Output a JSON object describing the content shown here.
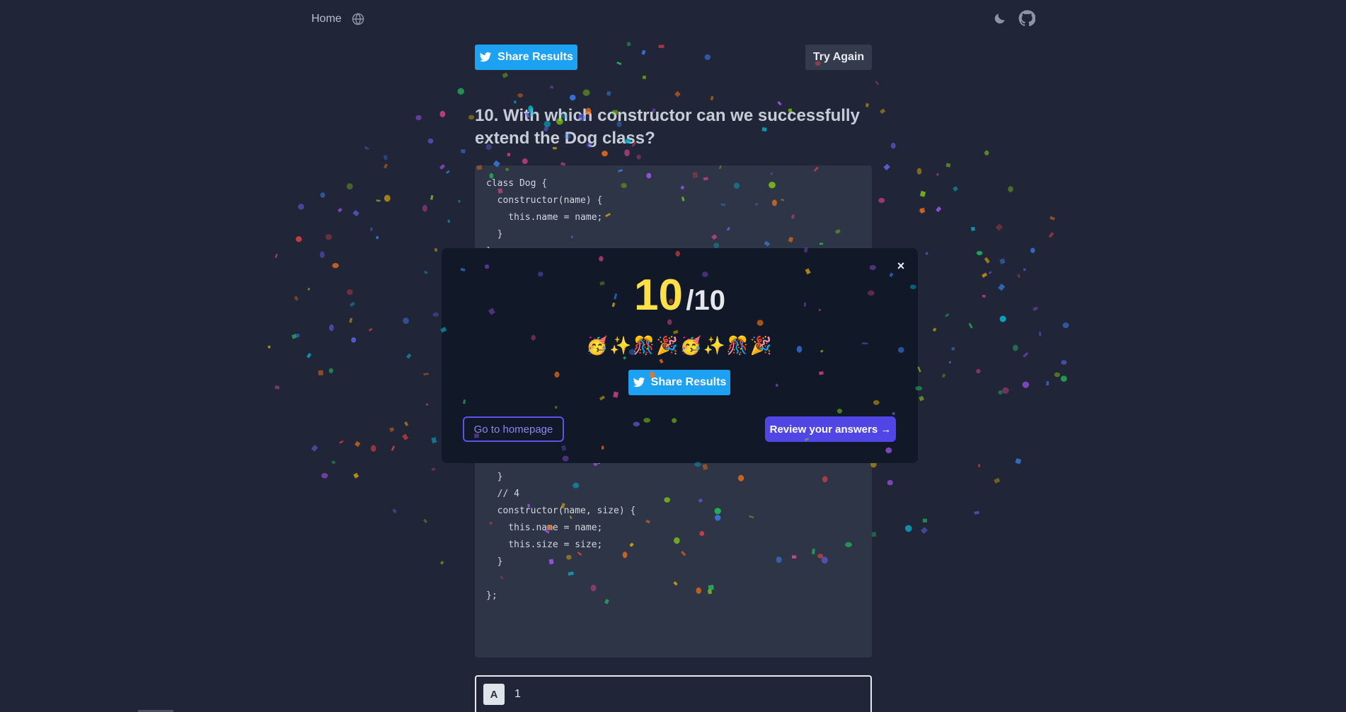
{
  "nav": {
    "home": "Home",
    "globe_icon": "globe-icon",
    "theme_icon": "moon-icon",
    "repo_icon": "github-icon"
  },
  "quiz": {
    "share_label": "Share Results",
    "try_again_label": "Try Again",
    "question": "10. With which constructor can we successfully extend the Dog class?",
    "code_top": "class Dog {\n  constructor(name) {\n    this.name = name;\n  }\n};",
    "code_bottom": "  constructor(size) {\n    super(name);\n    this.size = size;\n  }\n  // 4\n  constructor(name, size) {\n    this.name = name;\n    this.size = size;\n  }\n\n};",
    "answer": {
      "letter": "A",
      "text": "1"
    }
  },
  "modal": {
    "close": "×",
    "score": "10",
    "total": "/10",
    "emojis": "🥳✨🎊🎉🥳✨🎊🎉",
    "share_label": "Share Results",
    "home_label": "Go to homepage",
    "review_label": "Review your answers →"
  },
  "colors": {
    "background": "#202637",
    "accent_twitter": "#1da1f2",
    "accent_indigo": "#4f46e5",
    "score_yellow": "#fde047",
    "modal_bg": "#111827"
  }
}
